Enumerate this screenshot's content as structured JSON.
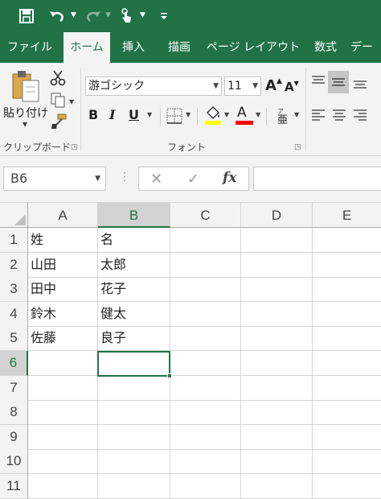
{
  "quick_access": {
    "icons": [
      "save-icon",
      "undo-icon",
      "redo-icon",
      "touch-mode-icon",
      "customize-icon"
    ]
  },
  "tabs": [
    {
      "label": "ファイル",
      "active": false
    },
    {
      "label": "ホーム",
      "active": true
    },
    {
      "label": "挿入",
      "active": false
    },
    {
      "label": "描画",
      "active": false
    },
    {
      "label": "ページ レイアウト",
      "active": false
    },
    {
      "label": "数式",
      "active": false
    },
    {
      "label": "デー",
      "active": false
    }
  ],
  "clipboard": {
    "paste_label": "貼り付け",
    "group_label": "クリップボード"
  },
  "font": {
    "font_name": "游ゴシック",
    "font_size": "11",
    "bold": "B",
    "italic": "I",
    "underline": "U",
    "grow_font": "A",
    "shrink_font": "A",
    "font_color_glyph": "A",
    "group_label": "フォント",
    "fill_color": "#ffff00",
    "font_color": "#ff0000"
  },
  "formula_bar": {
    "name_box": "B6",
    "fx": "fx",
    "formula": ""
  },
  "accent_color": "#217346",
  "sheet": {
    "columns": [
      "A",
      "B",
      "C",
      "D",
      "E"
    ],
    "selected_column": "B",
    "selected_row": "6",
    "rows": [
      {
        "num": "1",
        "cells": [
          "姓",
          "名",
          "",
          "",
          ""
        ]
      },
      {
        "num": "2",
        "cells": [
          "山田",
          "太郎",
          "",
          "",
          ""
        ]
      },
      {
        "num": "3",
        "cells": [
          "田中",
          "花子",
          "",
          "",
          ""
        ]
      },
      {
        "num": "4",
        "cells": [
          "鈴木",
          "健太",
          "",
          "",
          ""
        ]
      },
      {
        "num": "5",
        "cells": [
          "佐藤",
          "良子",
          "",
          "",
          ""
        ]
      },
      {
        "num": "6",
        "cells": [
          "",
          "",
          "",
          "",
          ""
        ]
      },
      {
        "num": "7",
        "cells": [
          "",
          "",
          "",
          "",
          ""
        ]
      },
      {
        "num": "8",
        "cells": [
          "",
          "",
          "",
          "",
          ""
        ]
      },
      {
        "num": "9",
        "cells": [
          "",
          "",
          "",
          "",
          ""
        ]
      },
      {
        "num": "10",
        "cells": [
          "",
          "",
          "",
          "",
          ""
        ]
      },
      {
        "num": "11",
        "cells": [
          "",
          "",
          "",
          "",
          ""
        ]
      }
    ]
  }
}
